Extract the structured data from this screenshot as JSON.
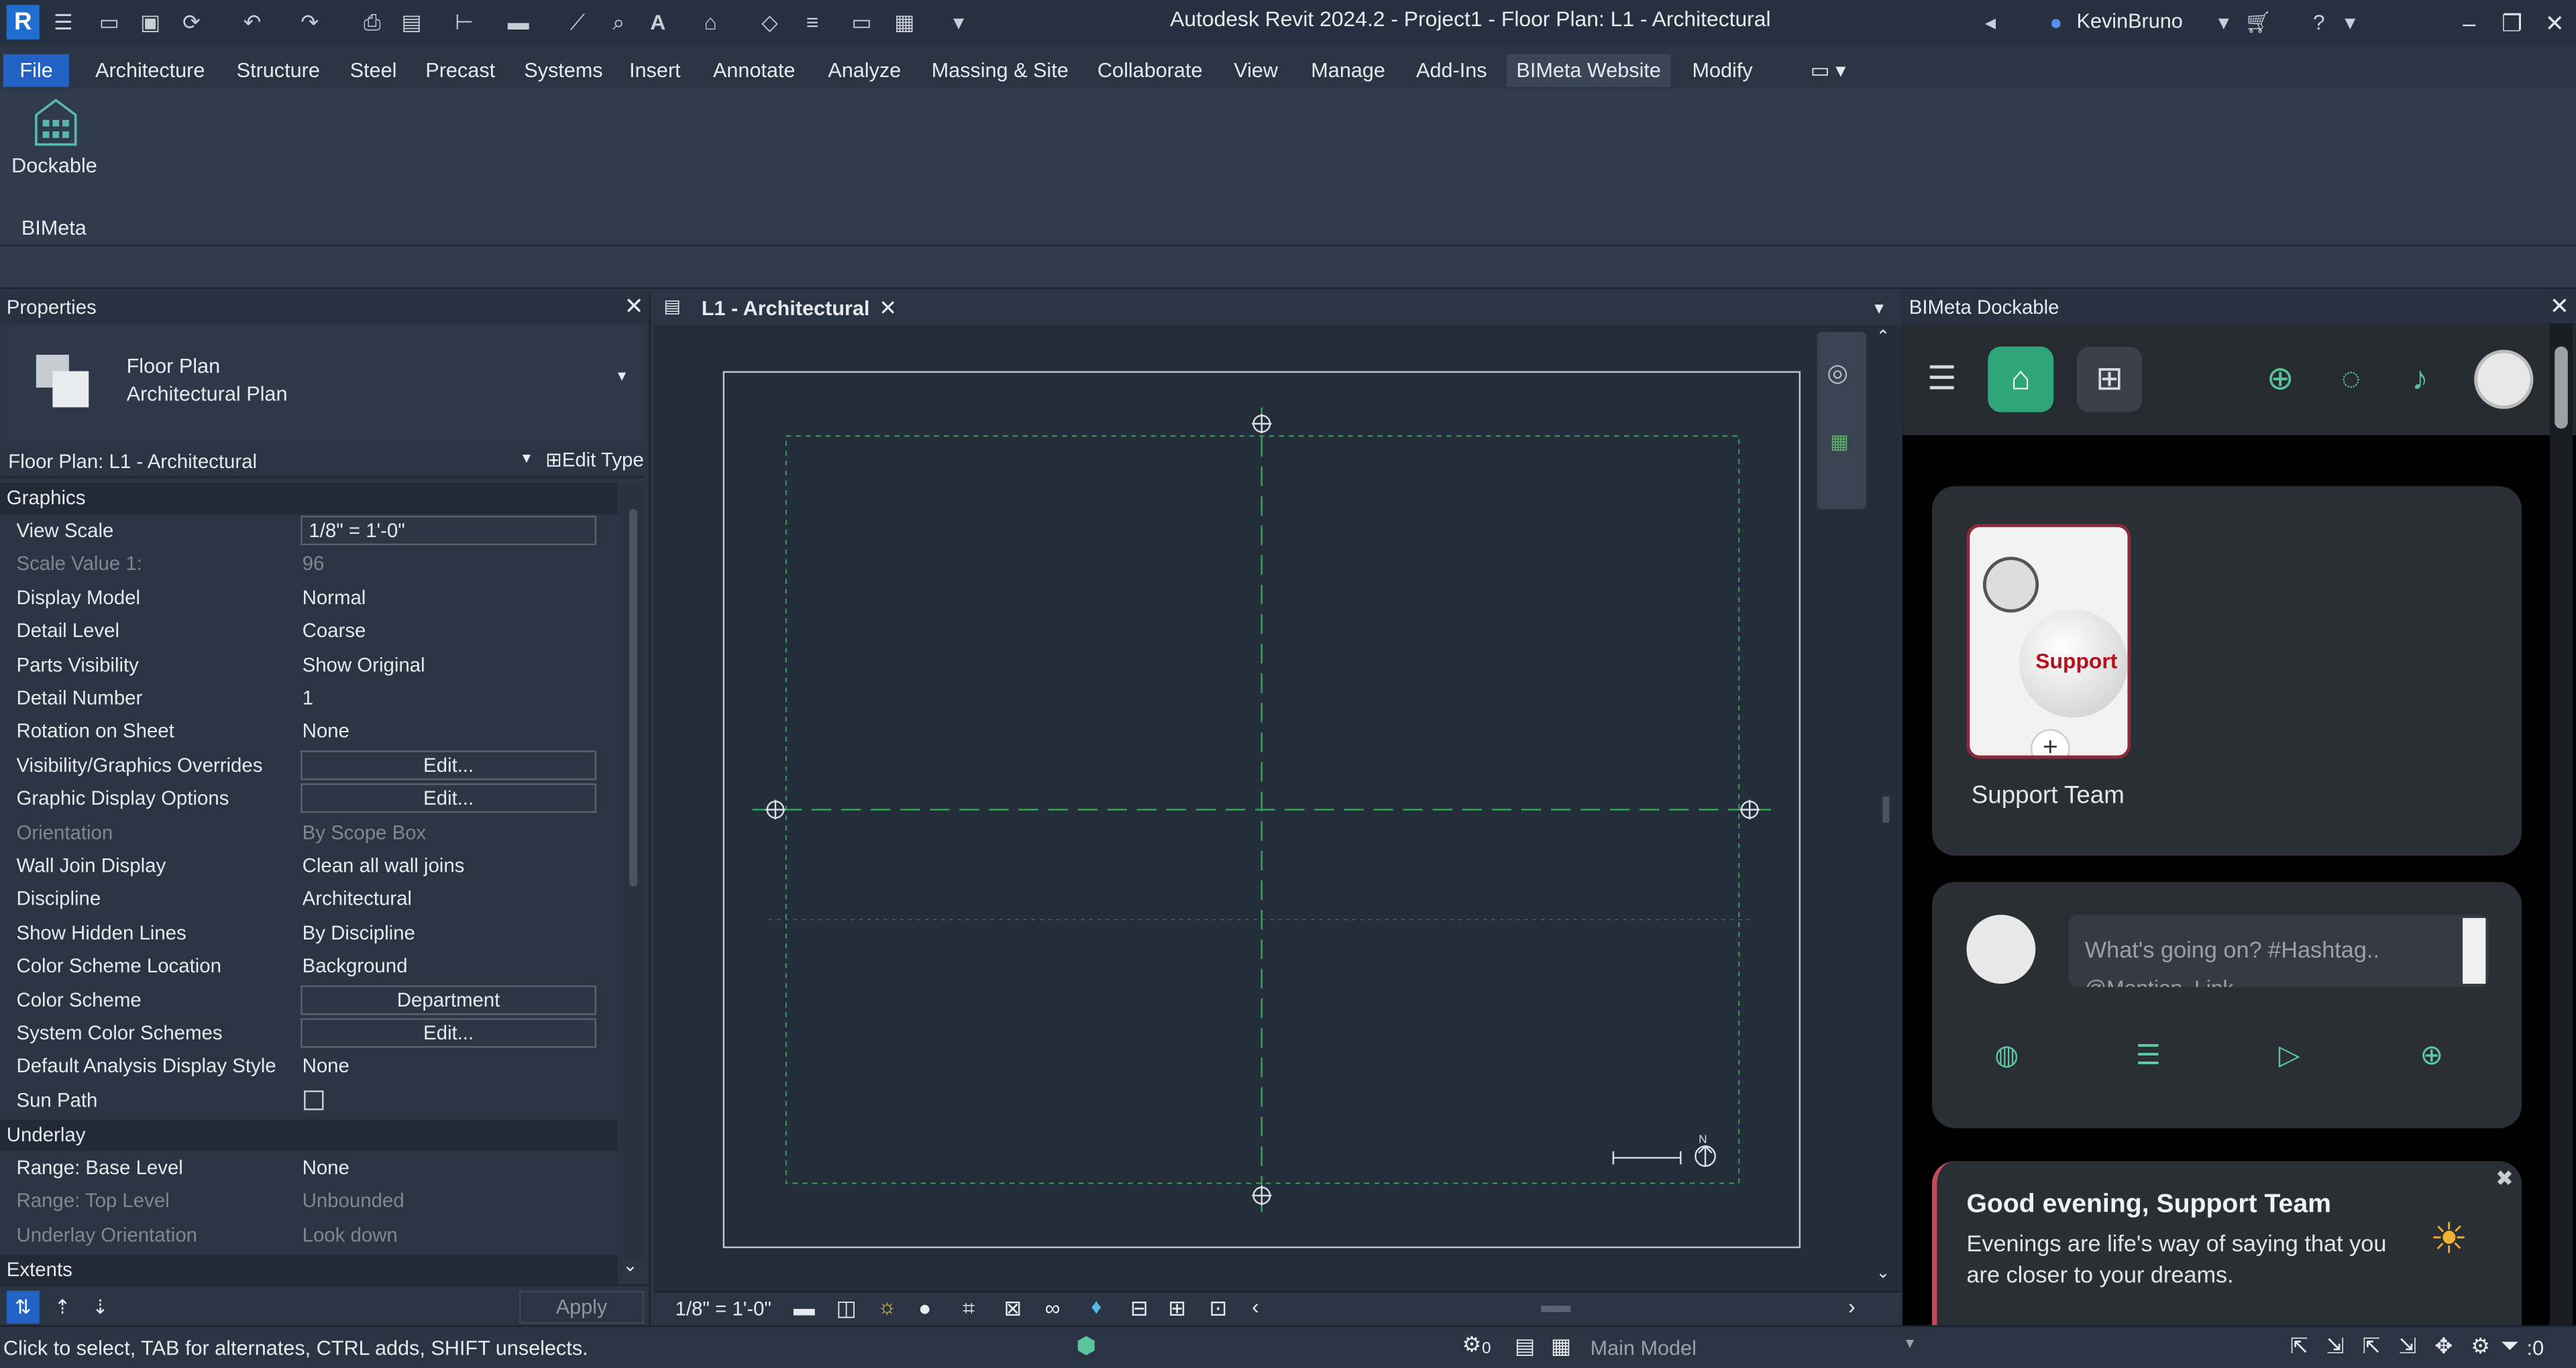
{
  "title_bar": {
    "app_title": "Autodesk Revit 2024.2 - Project1 - Floor Plan: L1 - Architectural",
    "user": "KevinBruno",
    "logo_letter": "R"
  },
  "menu": {
    "items": [
      "File",
      "Architecture",
      "Structure",
      "Steel",
      "Precast",
      "Systems",
      "Insert",
      "Annotate",
      "Analyze",
      "Massing & Site",
      "Collaborate",
      "View",
      "Manage",
      "Add-Ins",
      "BIMeta Website",
      "Modify"
    ]
  },
  "ribbon": {
    "button_label": "Dockable",
    "panel_label": "BIMeta"
  },
  "properties": {
    "title": "Properties",
    "type_name": "Floor Plan",
    "type_sub": "Architectural Plan",
    "instance_selector": "Floor Plan: L1 - Architectural",
    "edit_type": "Edit Type",
    "section_graphics": "Graphics",
    "rows": [
      {
        "k": "View Scale",
        "v": "1/8\" = 1'-0\""
      },
      {
        "k": "Scale Value    1:",
        "v": "96"
      },
      {
        "k": "Display Model",
        "v": "Normal"
      },
      {
        "k": "Detail Level",
        "v": "Coarse"
      },
      {
        "k": "Parts Visibility",
        "v": "Show Original"
      },
      {
        "k": "Detail Number",
        "v": "1"
      },
      {
        "k": "Rotation on Sheet",
        "v": "None"
      },
      {
        "k": "Visibility/Graphics Overrides",
        "v": "Edit..."
      },
      {
        "k": "Graphic Display Options",
        "v": "Edit..."
      },
      {
        "k": "Orientation",
        "v": "By Scope Box"
      },
      {
        "k": "Wall Join Display",
        "v": "Clean all wall joins"
      },
      {
        "k": "Discipline",
        "v": "Architectural"
      },
      {
        "k": "Show Hidden Lines",
        "v": "By Discipline"
      },
      {
        "k": "Color Scheme Location",
        "v": "Background"
      },
      {
        "k": "Color Scheme",
        "v": "Department"
      },
      {
        "k": "System Color Schemes",
        "v": "Edit..."
      },
      {
        "k": "Default Analysis Display Style",
        "v": "None"
      },
      {
        "k": "Sun Path",
        "v": ""
      }
    ],
    "section_underlay": "Underlay",
    "underlay_rows": [
      {
        "k": "Range: Base Level",
        "v": "None"
      },
      {
        "k": "Range: Top Level",
        "v": "Unbounded"
      },
      {
        "k": "Underlay Orientation",
        "v": "Look down"
      }
    ],
    "section_extents": "Extents",
    "apply": "Apply"
  },
  "view": {
    "tab_label": "L1 - Architectural",
    "scale_label": "1/8\" = 1'-0\"",
    "north_label": "N"
  },
  "dock": {
    "title": "BIMeta Dockable",
    "support_badge": "Support",
    "support_name": "Support Team",
    "post_placeholder": "What's going on? #Hashtag..",
    "post_placeholder_2": "@Mention, Link",
    "greeting_title": "Good evening, Support Team",
    "greeting_text": "Evenings are life's way of saying that you are closer to your dreams."
  },
  "status": {
    "hint": "Click to select, TAB for alternates, CTRL adds, SHIFT unselects.",
    "model": "Main Model",
    "selection_count": ":0",
    "worksharing_count": "0"
  },
  "colors": {
    "accent_blue": "#2162c4",
    "home_green": "#2fa67a",
    "grid_green": "#3aa05a"
  }
}
